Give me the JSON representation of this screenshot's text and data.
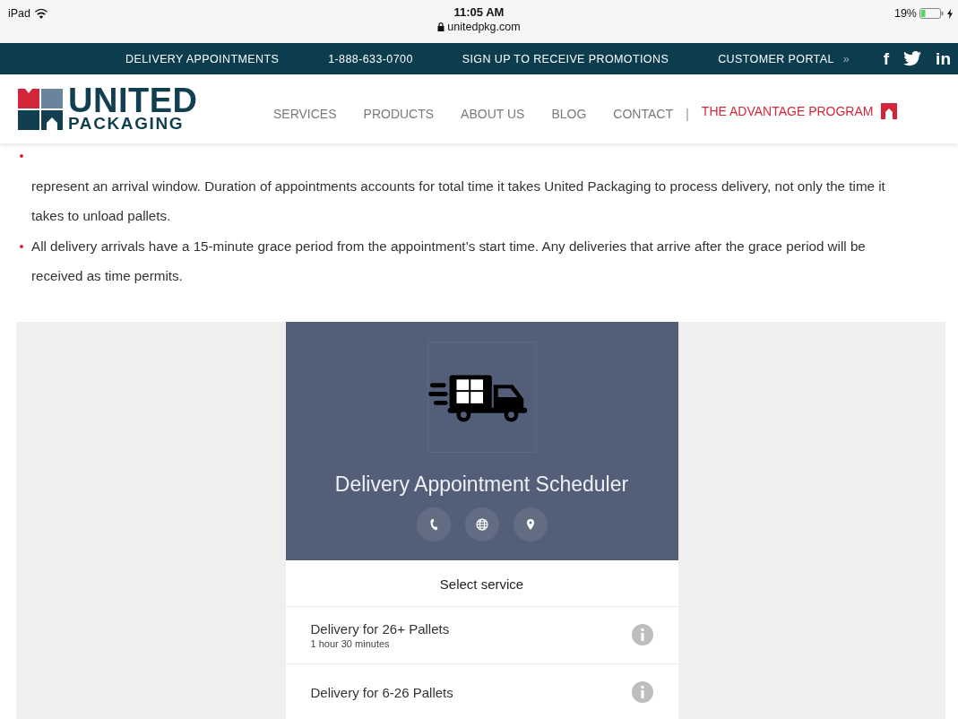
{
  "status_bar": {
    "device": "iPad",
    "time": "11:05 AM",
    "url": "unitedpkg.com",
    "battery": "19%"
  },
  "top_bar": {
    "links": [
      {
        "label": "DELIVERY APPOINTMENTS"
      },
      {
        "label": "1-888-633-0700"
      },
      {
        "label": "SIGN UP TO RECEIVE PROMOTIONS"
      },
      {
        "label": "CUSTOMER PORTAL",
        "arrow": "»"
      }
    ],
    "social": [
      {
        "kind": "glyph",
        "label": "f"
      },
      {
        "kind": "bird"
      },
      {
        "kind": "glyph",
        "label": "in"
      }
    ]
  },
  "logo": {
    "line_1": "UNITED",
    "line_2": "PACKAGING"
  },
  "nav": {
    "items": [
      "SERVICES",
      "PRODUCTS",
      "ABOUT US",
      "BLOG",
      "CONTACT"
    ],
    "separator": "|",
    "highlight": "THE ADVANTAGE PROGRAM"
  },
  "bullets": [
    {
      "text": "represent an arrival window. Duration of appointments accounts for total time it takes United Packaging to process delivery, not only the time it takes to unload pallets.",
      "first_line_hidden": true
    },
    {
      "text": "All delivery arrivals have a 15-minute grace period from the appointment’s start time. Any deliveries that arrive after the grace period will be received as time permits."
    }
  ],
  "scheduler": {
    "title": "Delivery Appointment Scheduler",
    "contact_buttons": [
      {
        "kind": "phone"
      },
      {
        "kind": "globe"
      },
      {
        "kind": "pin"
      }
    ],
    "section": "Select service",
    "services": [
      {
        "name": "Delivery for 26+ Pallets",
        "duration": "1 hour 30 minutes"
      },
      {
        "name": "Delivery for 6-26 Pallets"
      }
    ]
  }
}
